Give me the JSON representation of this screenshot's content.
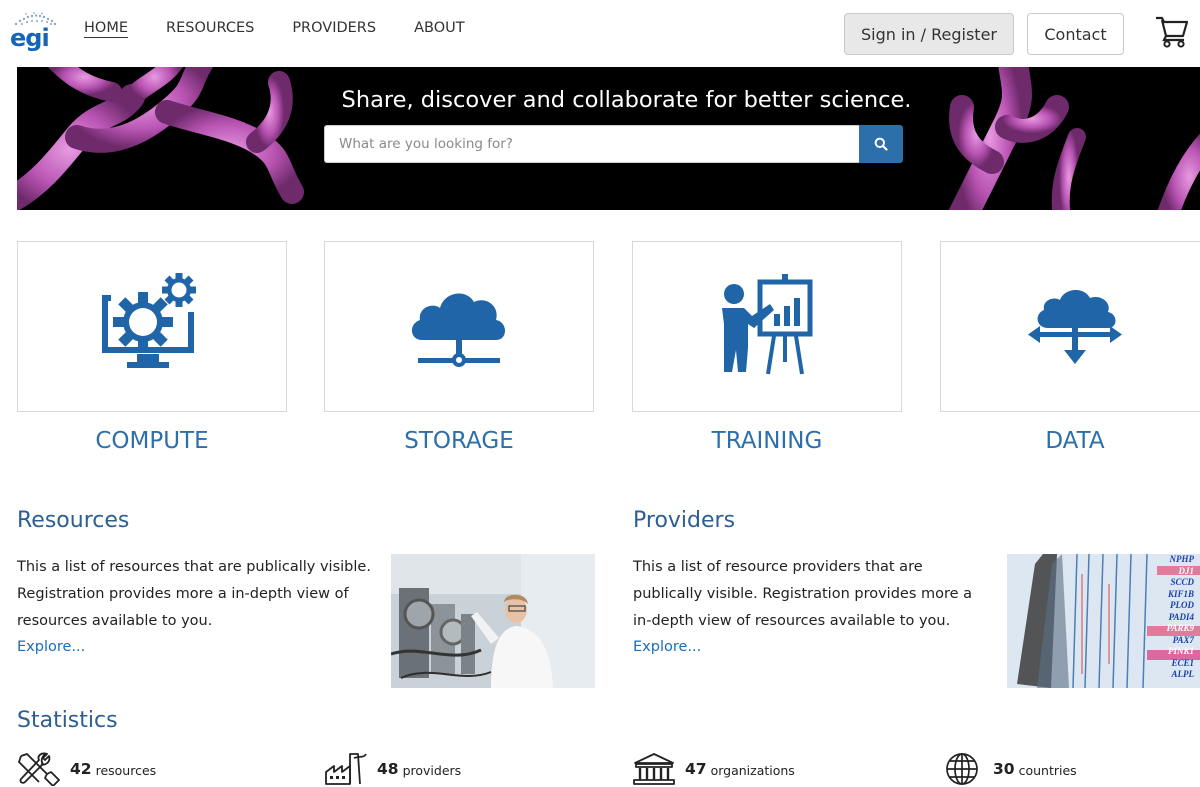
{
  "header": {
    "logo_text": "egi",
    "nav": [
      {
        "label": "HOME",
        "active": true
      },
      {
        "label": "RESOURCES",
        "active": false
      },
      {
        "label": "PROVIDERS",
        "active": false
      },
      {
        "label": "ABOUT",
        "active": false
      }
    ],
    "signin_label": "Sign in / Register",
    "contact_label": "Contact",
    "cart_icon": "shopping-cart-icon"
  },
  "hero": {
    "title": "Share, discover and collaborate for better science.",
    "search_placeholder": "What are you looking for?",
    "search_icon": "search-icon"
  },
  "categories": [
    {
      "label": "COMPUTE",
      "icon": "compute-gears-monitor-icon"
    },
    {
      "label": "STORAGE",
      "icon": "cloud-storage-icon"
    },
    {
      "label": "TRAINING",
      "icon": "presentation-training-icon"
    },
    {
      "label": "DATA",
      "icon": "cloud-data-transfer-icon"
    }
  ],
  "resources": {
    "title": "Resources",
    "text": "This a list of resources that are publically visible. Registration provides more a in-depth view of resources available to you.",
    "explore": "Explore..."
  },
  "providers": {
    "title": "Providers",
    "text": "This a list of resource providers that are publically visible. Registration provides more a in-depth view of resources available to you.",
    "explore": "Explore...",
    "gene_labels": [
      "NPHP",
      "DJ1",
      "SCCD",
      "KIF1B",
      "PLOD",
      "PADI4",
      "PARK9",
      "PAX7",
      "PINK1",
      "ECE1",
      "ALPL"
    ]
  },
  "statistics": {
    "title": "Statistics",
    "items": [
      {
        "value": "42",
        "label": "resources",
        "icon": "tools-icon"
      },
      {
        "value": "48",
        "label": "providers",
        "icon": "factory-icon"
      },
      {
        "value": "47",
        "label": "organizations",
        "icon": "institution-building-icon"
      },
      {
        "value": "30",
        "label": "countries",
        "icon": "globe-icon"
      }
    ]
  },
  "colors": {
    "accent": "#2d6fab",
    "heading": "#2d5f94",
    "link": "#1a6eb8"
  }
}
